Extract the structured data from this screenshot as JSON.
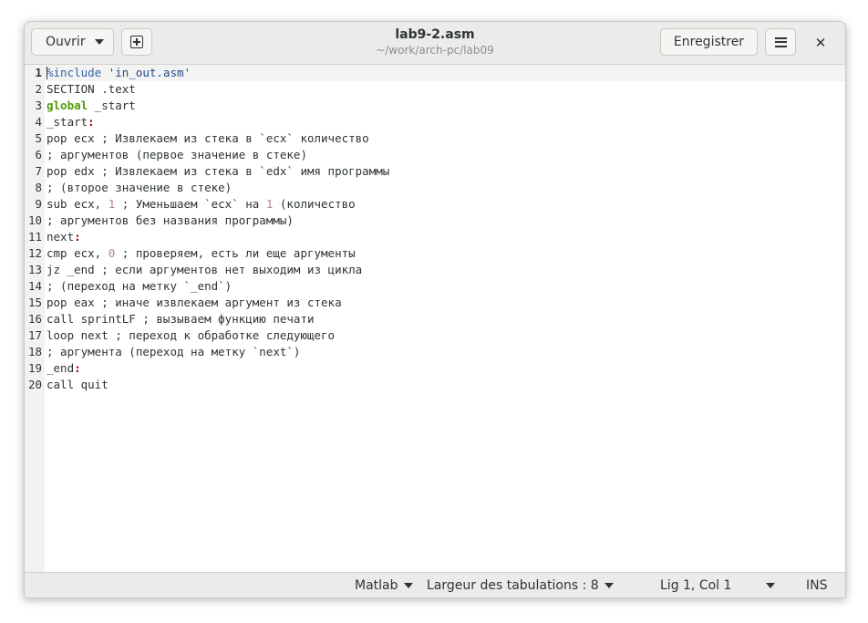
{
  "header": {
    "open_label": "Ouvrir",
    "title": "lab9-2.asm",
    "subtitle": "~/work/arch-pc/lab09",
    "save_label": "Enregistrer"
  },
  "icons": {
    "open_dropdown": "chevron-down-icon",
    "new_tab": "new-tab-icon",
    "menu": "hamburger-menu-icon",
    "close": "close-icon"
  },
  "colors": {
    "keyword": "#4e9a06",
    "directive": "#3465a4",
    "string": "#204a87",
    "number": "#b0869a",
    "label_colon": "#a40000",
    "text": "#2e3436"
  },
  "editor": {
    "current_line": 1,
    "lines": [
      [
        {
          "t": "%include",
          "c": "directive"
        },
        {
          "t": " "
        },
        {
          "t": "'in_out.asm'",
          "c": "string"
        }
      ],
      [
        {
          "t": "SECTION .text"
        }
      ],
      [
        {
          "t": "global",
          "c": "keyword"
        },
        {
          "t": " _start"
        }
      ],
      [
        {
          "t": "_start"
        },
        {
          "t": ":",
          "c": "label_colon"
        }
      ],
      [
        {
          "t": "pop ecx ; Извлекаем из стека в `ecx` количество"
        }
      ],
      [
        {
          "t": "; аргументов (первое значение в стеке)"
        }
      ],
      [
        {
          "t": "pop edx ; Извлекаем из стека в `edx` имя программы"
        }
      ],
      [
        {
          "t": "; (второе значение в стеке)"
        }
      ],
      [
        {
          "t": "sub ecx, "
        },
        {
          "t": "1",
          "c": "number"
        },
        {
          "t": " ; Уменьшаем `ecx` на "
        },
        {
          "t": "1",
          "c": "number"
        },
        {
          "t": " (количество"
        }
      ],
      [
        {
          "t": "; аргументов без названия программы)"
        }
      ],
      [
        {
          "t": "next"
        },
        {
          "t": ":",
          "c": "label_colon"
        }
      ],
      [
        {
          "t": "cmp ecx, "
        },
        {
          "t": "0",
          "c": "number"
        },
        {
          "t": " ; проверяем, есть ли еще аргументы"
        }
      ],
      [
        {
          "t": "jz _end ; если аргументов нет выходим из цикла"
        }
      ],
      [
        {
          "t": "; (переход на метку `_end`)"
        }
      ],
      [
        {
          "t": "pop eax ; иначе извлекаем аргумент из стека"
        }
      ],
      [
        {
          "t": "call sprintLF ; вызываем функцию печати"
        }
      ],
      [
        {
          "t": "loop next ; переход к обработке следующего"
        }
      ],
      [
        {
          "t": "; аргумента (переход на метку `next`)"
        }
      ],
      [
        {
          "t": "_end"
        },
        {
          "t": ":",
          "c": "label_colon"
        }
      ],
      [
        {
          "t": "call quit"
        }
      ]
    ]
  },
  "status": {
    "language": "Matlab",
    "tab_width": "Largeur des tabulations : 8",
    "position": "Lig 1, Col 1",
    "mode": "INS"
  }
}
